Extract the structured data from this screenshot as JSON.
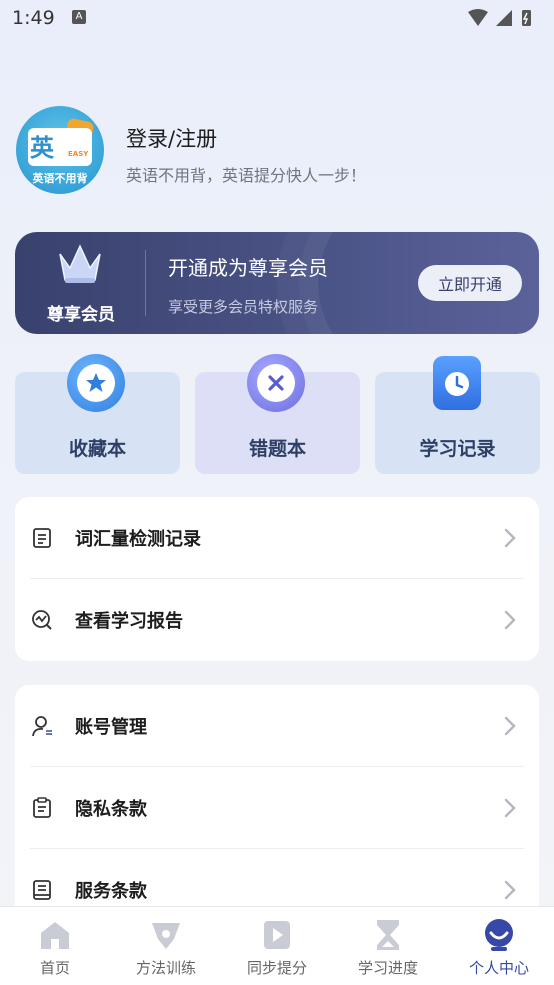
{
  "status_bar": {
    "time": "1:49",
    "notification_glyph": "A"
  },
  "profile": {
    "avatar_text_large": "英",
    "avatar_text_small": "EASY",
    "avatar_caption": "英语不用背",
    "title": "登录/注册",
    "subtitle": "英语不用背，英语提分快人一步！"
  },
  "vip": {
    "badge_label": "尊享会员",
    "title": "开通成为尊享会员",
    "subtitle": "享受更多会员特权服务",
    "button_label": "立即开通"
  },
  "quick_cards": [
    {
      "label": "收藏本",
      "icon": "star-icon",
      "color": "#3b8fe8"
    },
    {
      "label": "错题本",
      "icon": "close-icon",
      "color": "#6c6fe0"
    },
    {
      "label": "学习记录",
      "icon": "calendar-clock-icon",
      "color": "#3a7ce8"
    }
  ],
  "list_group_1": [
    {
      "label": "词汇量检测记录",
      "icon": "document-icon"
    },
    {
      "label": "查看学习报告",
      "icon": "report-icon"
    }
  ],
  "list_group_2": [
    {
      "label": "账号管理",
      "icon": "account-icon"
    },
    {
      "label": "隐私条款",
      "icon": "clipboard-icon"
    },
    {
      "label": "服务条款",
      "icon": "terms-icon"
    }
  ],
  "tabs": [
    {
      "label": "首页",
      "icon": "home-icon"
    },
    {
      "label": "方法训练",
      "icon": "method-icon"
    },
    {
      "label": "同步提分",
      "icon": "sync-icon"
    },
    {
      "label": "学习进度",
      "icon": "hourglass-icon"
    },
    {
      "label": "个人中心",
      "icon": "profile-icon",
      "active": true
    }
  ],
  "colors": {
    "accent": "#3848a8",
    "vip_bg": "#414a7b",
    "inactive_icon": "#c9ccd4"
  }
}
